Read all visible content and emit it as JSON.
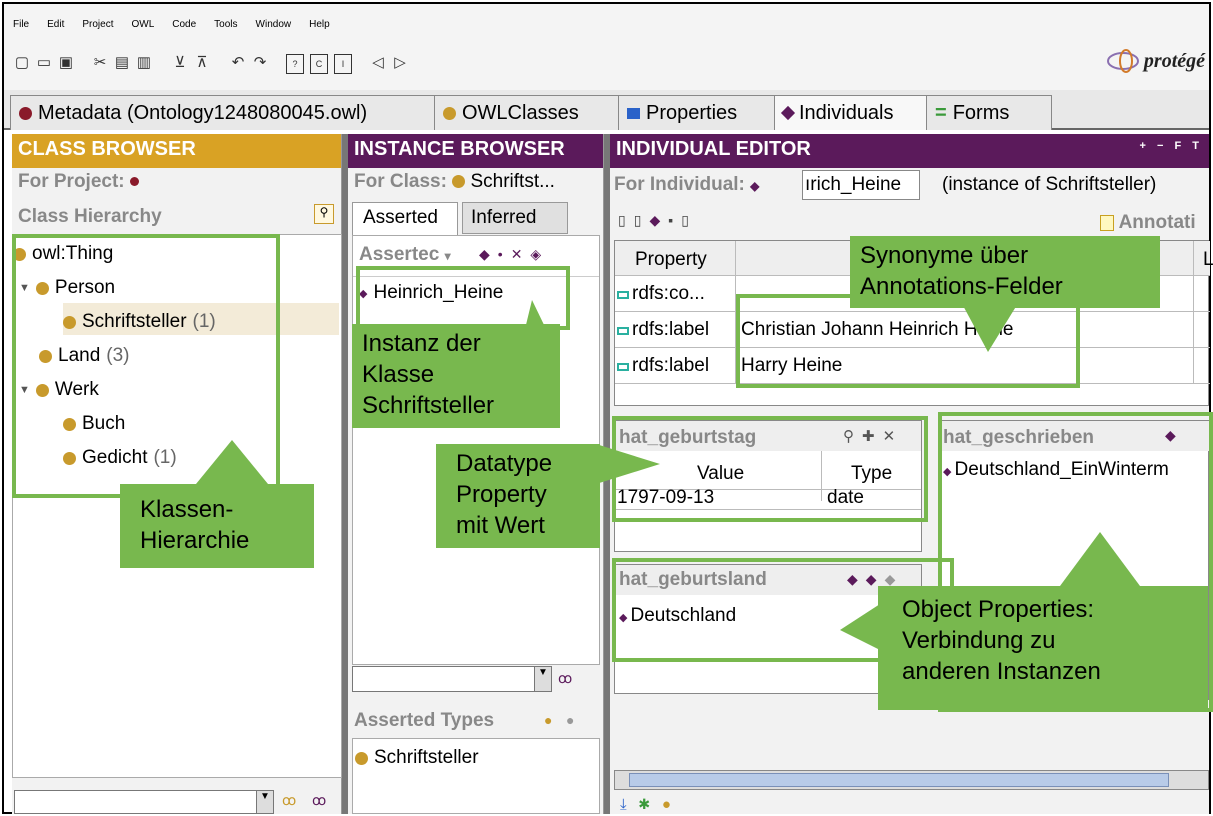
{
  "menu": [
    "File",
    "Edit",
    "Project",
    "OWL",
    "Code",
    "Tools",
    "Window",
    "Help"
  ],
  "logo": "protégé",
  "tabs": [
    {
      "label": "Metadata (Ontology1248080045.owl)",
      "icon": "maroon-dot-icon"
    },
    {
      "label": "OWLClasses",
      "icon": "gold-dot-icon"
    },
    {
      "label": "Properties",
      "icon": "blue-square-icon"
    },
    {
      "label": "Individuals",
      "icon": "purple-diamond-icon"
    },
    {
      "label": "Forms",
      "icon": "green-form-icon"
    }
  ],
  "class_browser": {
    "title": "CLASS BROWSER",
    "for_project": "For Project:",
    "hierarchy_label": "Class Hierarchy",
    "tree": [
      {
        "label": "owl:Thing",
        "count": ""
      },
      {
        "label": "Person",
        "count": ""
      },
      {
        "label": "Schriftsteller",
        "count": "(1)"
      },
      {
        "label": "Land",
        "count": "(3)"
      },
      {
        "label": "Werk",
        "count": ""
      },
      {
        "label": "Buch",
        "count": ""
      },
      {
        "label": "Gedicht",
        "count": "(1)"
      }
    ]
  },
  "instance_browser": {
    "title": "INSTANCE BROWSER",
    "for_class": "For Class:",
    "for_class_value": "Schriftst...",
    "tab_asserted": "Asserted",
    "tab_inferred": "Inferred",
    "list_header": "Assertec",
    "instances": [
      "Heinrich_Heine"
    ],
    "asserted_types_label": "Asserted Types",
    "asserted_types": [
      "Schriftsteller"
    ]
  },
  "individual_editor": {
    "title": "INDIVIDUAL EDITOR",
    "title_tools": "+ − F T",
    "for_individual": "For Individual:",
    "individual_value": "ırich_Heine",
    "instance_of": "(instance of Schriftsteller)",
    "annotations_label": "Annotati",
    "table_header": [
      "Property",
      "",
      "L"
    ],
    "rows": [
      {
        "property": "rdfs:co...",
        "value": ""
      },
      {
        "property": "rdfs:label",
        "value": "Christian Johann Heinrich Heine"
      },
      {
        "property": "rdfs:label",
        "value": "Harry Heine"
      }
    ],
    "geburtstag": {
      "title": "hat_geburtstag",
      "col_value": "Value",
      "col_type": "Type",
      "value": "1797-09-13",
      "type": "date"
    },
    "geschrieben": {
      "title": "hat_geschrieben",
      "items": [
        "Deutschland_EinWinterm"
      ]
    },
    "geburtsland": {
      "title": "hat_geburtsland",
      "items": [
        "Deutschland"
      ]
    }
  },
  "callouts": {
    "klassen": "Klassen-\nHierarchie",
    "instanz": "Instanz der\nKlasse\nSchriftsteller",
    "datatype": "Datatype\nProperty\nmit Wert",
    "synonyme": "Synonyme über\nAnnotations-Felder",
    "object": "Object Properties:\nVerbindung zu\nanderen Instanzen"
  },
  "colors": {
    "class_head": "#d9a224",
    "instance_head": "#5b1a5b",
    "editor_head": "#5b1a5b",
    "callout_green": "#78b84e"
  }
}
